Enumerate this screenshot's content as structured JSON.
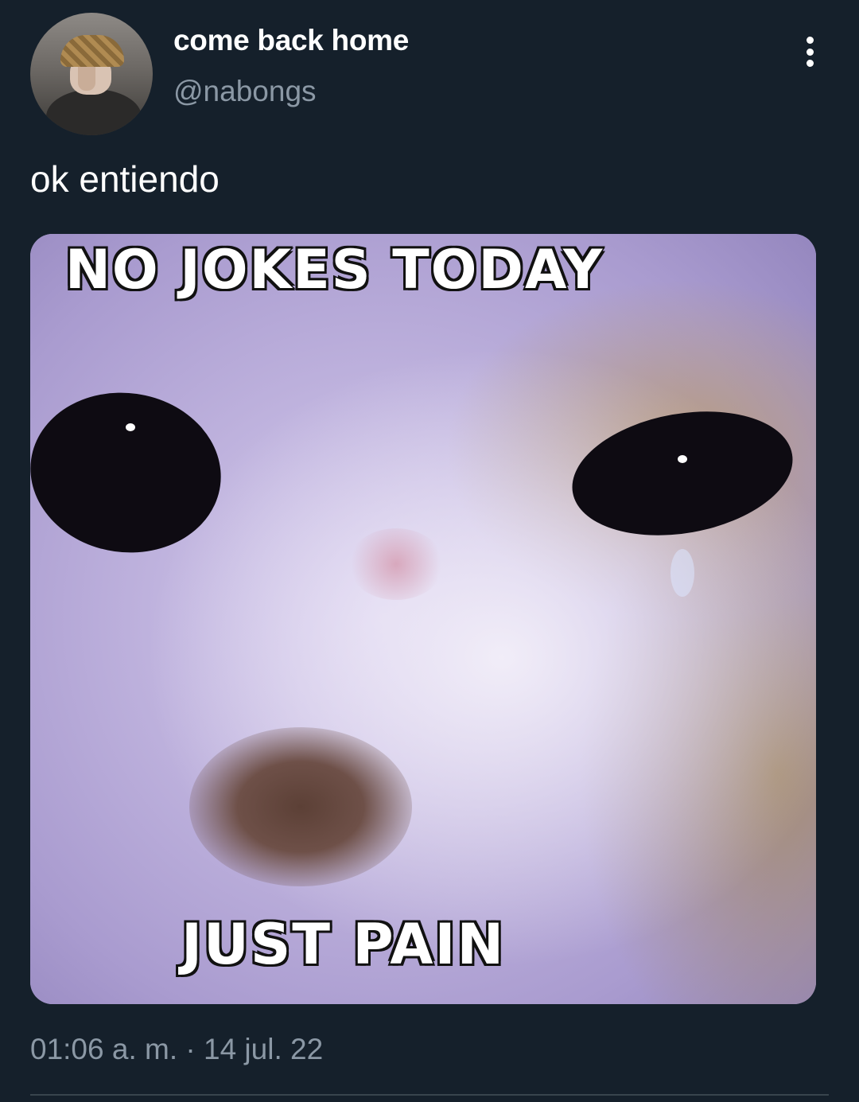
{
  "tweet": {
    "display_name": "come back home",
    "handle": "@nabongs",
    "text": "ok entiendo",
    "timestamp": "01:06 a. m. · 14 jul. 22",
    "more_icon": "more-vertical-icon"
  },
  "media": {
    "top_caption": "NO JOKES TODAY",
    "bottom_caption": "JUST PAIN"
  },
  "colors": {
    "background": "#15202b",
    "secondary_text": "#8b98a5",
    "primary_text": "#ffffff"
  }
}
